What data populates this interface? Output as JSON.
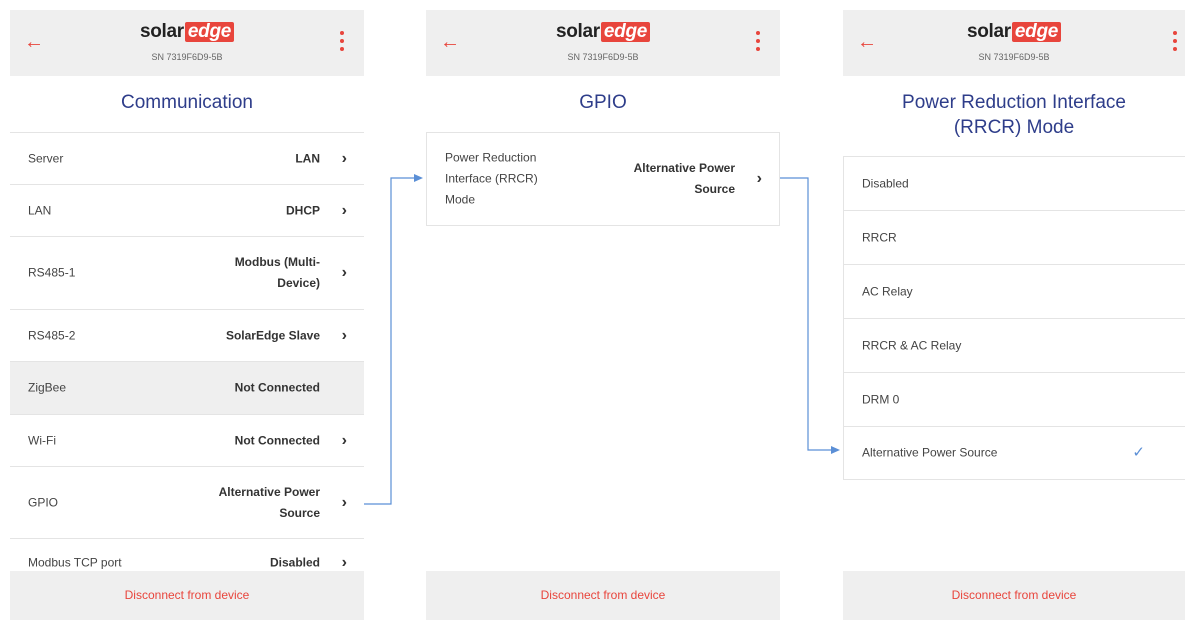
{
  "brand": {
    "word1": "solar",
    "word2": "edge"
  },
  "serial": "SN 7319F6D9-5B",
  "footer": {
    "disconnect_label": "Disconnect from device"
  },
  "icons": {
    "back": "arrow-left-icon",
    "menu": "more-vertical-icon",
    "chevron": "chevron-right-icon",
    "check": "check-icon"
  },
  "colors": {
    "accent": "#e8453c",
    "title": "#2e3d8a",
    "connector": "#5b8fd6"
  },
  "communication": {
    "title": "Communication",
    "rows": [
      {
        "label": "Server",
        "value": "LAN",
        "chevron": true
      },
      {
        "label": "LAN",
        "value": "DHCP",
        "chevron": true
      },
      {
        "label": "RS485-1",
        "value": "Modbus (Multi-Device)",
        "value_line1": "Modbus (Multi-",
        "value_line2": "Device)",
        "chevron": true
      },
      {
        "label": "RS485-2",
        "value": "SolarEdge Slave",
        "chevron": true
      },
      {
        "label": "ZigBee",
        "value": "Not Connected",
        "chevron": false,
        "selected": true
      },
      {
        "label": "Wi-Fi",
        "value": "Not Connected",
        "chevron": true
      },
      {
        "label": "GPIO",
        "value": "Alternative Power Source",
        "value_line1": "Alternative Power",
        "value_line2": "Source",
        "chevron": true
      },
      {
        "label": "Modbus TCP port",
        "value": "Disabled",
        "chevron": true
      }
    ]
  },
  "gpio": {
    "title": "GPIO",
    "rows": [
      {
        "label": "Power Reduction Interface (RRCR) Mode",
        "label_line1": "Power Reduction",
        "label_line2": "Interface (RRCR)",
        "label_line3": "Mode",
        "value": "Alternative Power Source",
        "value_line1": "Alternative Power",
        "value_line2": "Source",
        "chevron": true
      }
    ]
  },
  "rrcr": {
    "title": "Power Reduction Interface (RRCR) Mode",
    "title_line1": "Power Reduction Interface",
    "title_line2": "(RRCR) Mode",
    "options": [
      {
        "label": "Disabled",
        "checked": false
      },
      {
        "label": "RRCR",
        "checked": false
      },
      {
        "label": "AC Relay",
        "checked": false
      },
      {
        "label": "RRCR & AC Relay",
        "checked": false
      },
      {
        "label": "DRM 0",
        "checked": false
      },
      {
        "label": "Alternative Power Source",
        "checked": true
      }
    ]
  }
}
